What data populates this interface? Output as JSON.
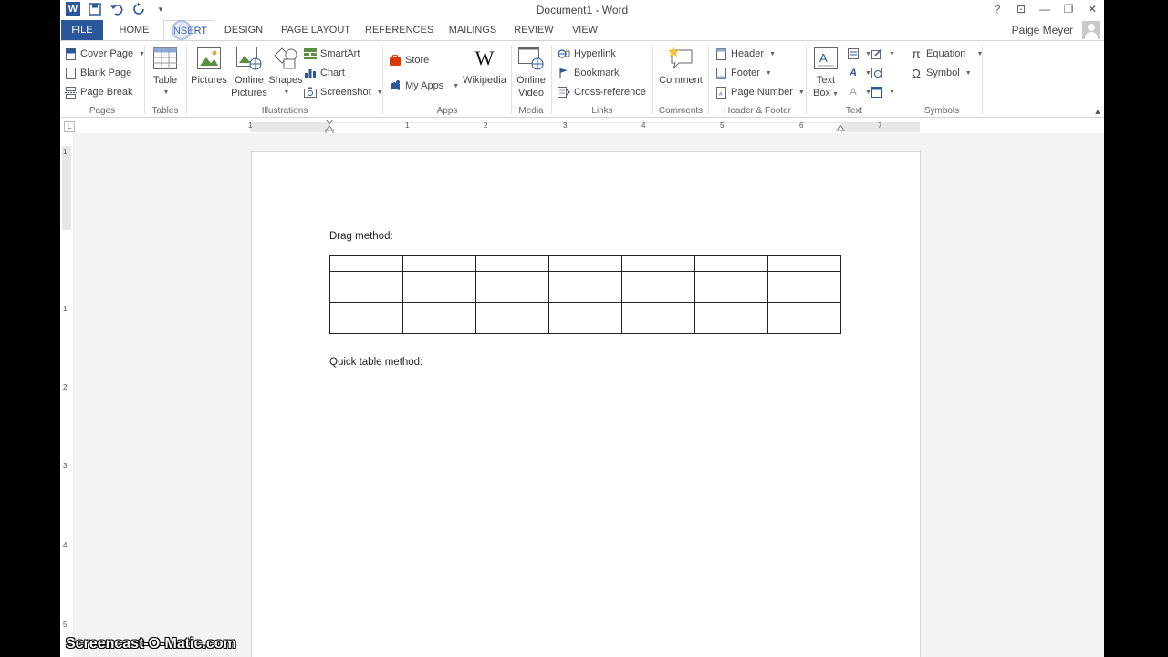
{
  "window": {
    "title": "Document1 - Word",
    "controls": [
      "?",
      "⊡",
      "—",
      "❐",
      "✕"
    ]
  },
  "user": {
    "name": "Paige Meyer"
  },
  "tabs": [
    {
      "label": "FILE"
    },
    {
      "label": "HOME"
    },
    {
      "label": "INSERT"
    },
    {
      "label": "DESIGN"
    },
    {
      "label": "PAGE LAYOUT"
    },
    {
      "label": "REFERENCES"
    },
    {
      "label": "MAILINGS"
    },
    {
      "label": "REVIEW"
    },
    {
      "label": "VIEW"
    }
  ],
  "active_tab": "INSERT",
  "ribbon": {
    "pages": {
      "label": "Pages",
      "cover_page": "Cover Page",
      "blank_page": "Blank Page",
      "page_break": "Page Break"
    },
    "tables": {
      "label": "Tables",
      "table": "Table"
    },
    "illustrations": {
      "label": "Illustrations",
      "pictures": "Pictures",
      "online_pictures_1": "Online",
      "online_pictures_2": "Pictures",
      "shapes": "Shapes",
      "smartart": "SmartArt",
      "chart": "Chart",
      "screenshot": "Screenshot"
    },
    "apps": {
      "label": "Apps",
      "store": "Store",
      "my_apps": "My Apps",
      "wikipedia": "Wikipedia"
    },
    "media": {
      "label": "Media",
      "online_video_1": "Online",
      "online_video_2": "Video"
    },
    "links": {
      "label": "Links",
      "hyperlink": "Hyperlink",
      "bookmark": "Bookmark",
      "cross_reference": "Cross-reference"
    },
    "comments": {
      "label": "Comments",
      "comment": "Comment"
    },
    "header_footer": {
      "label": "Header & Footer",
      "header": "Header",
      "footer": "Footer",
      "page_number": "Page Number"
    },
    "text": {
      "label": "Text",
      "text_box_1": "Text",
      "text_box_2": "Box"
    },
    "symbols": {
      "label": "Symbols",
      "equation": "Equation",
      "symbol": "Symbol"
    }
  },
  "ruler": {
    "numbers": [
      "1",
      "1",
      "2",
      "3",
      "4",
      "5",
      "6",
      "7"
    ],
    "vertical_numbers": [
      "1",
      "1",
      "2",
      "3",
      "4",
      "5"
    ]
  },
  "document": {
    "heading_1": "Drag method:",
    "table_rows": 5,
    "table_cols": 7,
    "heading_2": "Quick table method:"
  },
  "watermark": "Screencast-O-Matic.com",
  "colors": {
    "accent": "#2b579a",
    "file_tab": "#2b579a"
  }
}
